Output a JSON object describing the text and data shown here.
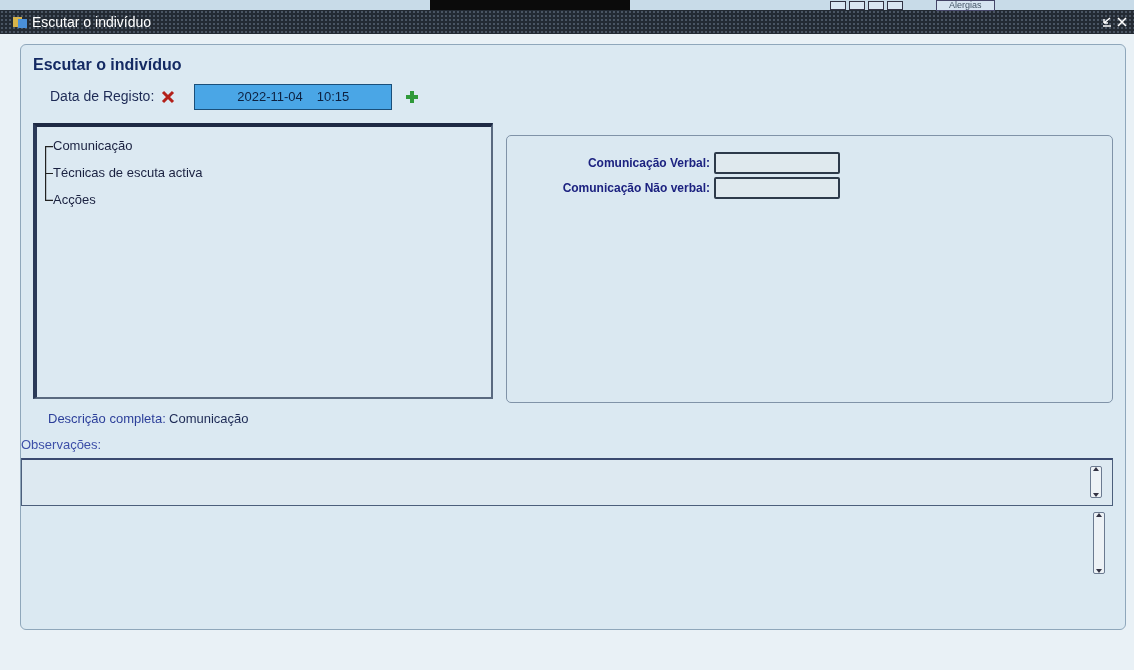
{
  "background_window": {
    "button": "Alergias"
  },
  "window": {
    "title": "Escutar o indivíduo"
  },
  "form": {
    "heading": "Escutar o indivíduo",
    "date_label": "Data de Registo:",
    "date_value": "2022-11-04",
    "time_value": "10:15"
  },
  "tree": {
    "items": [
      {
        "label": "Comunicação"
      },
      {
        "label": "Técnicas de escuta activa"
      },
      {
        "label": "Acções"
      }
    ]
  },
  "detail_fields": [
    {
      "label": "Comunicação Verbal:"
    },
    {
      "label": "Comunicação Não verbal:"
    }
  ],
  "description": {
    "label": "Descrição completa:",
    "value": "Comunicação"
  },
  "observations": {
    "label": "Observações:"
  }
}
